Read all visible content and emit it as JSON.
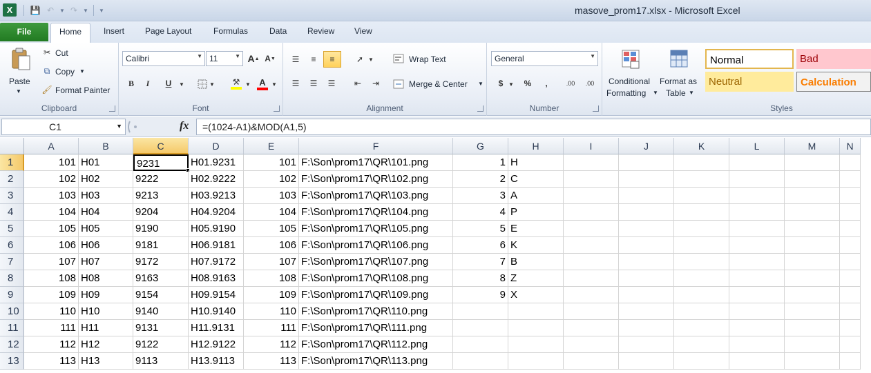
{
  "window": {
    "title": "masove_prom17.xlsx  -  Microsoft Excel"
  },
  "tabs": {
    "file": "File",
    "items": [
      "Home",
      "Insert",
      "Page Layout",
      "Formulas",
      "Data",
      "Review",
      "View"
    ]
  },
  "ribbon": {
    "clipboard": {
      "label": "Clipboard",
      "paste": "Paste",
      "cut": "Cut",
      "copy": "Copy",
      "format_painter": "Format Painter"
    },
    "font": {
      "label": "Font",
      "name": "Calibri",
      "size": "11"
    },
    "alignment": {
      "label": "Alignment",
      "wrap_text": "Wrap Text",
      "merge_center": "Merge & Center"
    },
    "number": {
      "label": "Number",
      "format": "General"
    },
    "styles": {
      "label": "Styles",
      "conditional": [
        "Conditional",
        "Formatting"
      ],
      "format_table": [
        "Format as",
        "Table"
      ],
      "normal": "Normal",
      "bad": "Bad",
      "neutral": "Neutral",
      "calculation": "Calculation"
    }
  },
  "formula_bar": {
    "name_box": "C1",
    "fx": "fx",
    "formula": "=(1024-A1)&MOD(A1,5)"
  },
  "sheet": {
    "columns": [
      "A",
      "B",
      "C",
      "D",
      "E",
      "F",
      "G",
      "H",
      "I",
      "J",
      "K",
      "L",
      "M",
      "N"
    ],
    "selected_col": "C",
    "selected_row": 1,
    "rows": [
      {
        "n": "1",
        "A": "101",
        "B": "H01",
        "C": "9231",
        "D": "H01.9231",
        "E": "101",
        "F": "F:\\Son\\prom17\\QR\\101.png",
        "G": "1",
        "H": "H"
      },
      {
        "n": "2",
        "A": "102",
        "B": "H02",
        "C": "9222",
        "D": "H02.9222",
        "E": "102",
        "F": "F:\\Son\\prom17\\QR\\102.png",
        "G": "2",
        "H": "C"
      },
      {
        "n": "3",
        "A": "103",
        "B": "H03",
        "C": "9213",
        "D": "H03.9213",
        "E": "103",
        "F": "F:\\Son\\prom17\\QR\\103.png",
        "G": "3",
        "H": "A"
      },
      {
        "n": "4",
        "A": "104",
        "B": "H04",
        "C": "9204",
        "D": "H04.9204",
        "E": "104",
        "F": "F:\\Son\\prom17\\QR\\104.png",
        "G": "4",
        "H": "P"
      },
      {
        "n": "5",
        "A": "105",
        "B": "H05",
        "C": "9190",
        "D": "H05.9190",
        "E": "105",
        "F": "F:\\Son\\prom17\\QR\\105.png",
        "G": "5",
        "H": "E"
      },
      {
        "n": "6",
        "A": "106",
        "B": "H06",
        "C": "9181",
        "D": "H06.9181",
        "E": "106",
        "F": "F:\\Son\\prom17\\QR\\106.png",
        "G": "6",
        "H": "K"
      },
      {
        "n": "7",
        "A": "107",
        "B": "H07",
        "C": "9172",
        "D": "H07.9172",
        "E": "107",
        "F": "F:\\Son\\prom17\\QR\\107.png",
        "G": "7",
        "H": "B"
      },
      {
        "n": "8",
        "A": "108",
        "B": "H08",
        "C": "9163",
        "D": "H08.9163",
        "E": "108",
        "F": "F:\\Son\\prom17\\QR\\108.png",
        "G": "8",
        "H": "Z"
      },
      {
        "n": "9",
        "A": "109",
        "B": "H09",
        "C": "9154",
        "D": "H09.9154",
        "E": "109",
        "F": "F:\\Son\\prom17\\QR\\109.png",
        "G": "9",
        "H": "X"
      },
      {
        "n": "10",
        "A": "110",
        "B": "H10",
        "C": "9140",
        "D": "H10.9140",
        "E": "110",
        "F": "F:\\Son\\prom17\\QR\\110.png",
        "G": "",
        "H": ""
      },
      {
        "n": "11",
        "A": "111",
        "B": "H11",
        "C": "9131",
        "D": "H11.9131",
        "E": "111",
        "F": "F:\\Son\\prom17\\QR\\111.png",
        "G": "",
        "H": ""
      },
      {
        "n": "12",
        "A": "112",
        "B": "H12",
        "C": "9122",
        "D": "H12.9122",
        "E": "112",
        "F": "F:\\Son\\prom17\\QR\\112.png",
        "G": "",
        "H": ""
      },
      {
        "n": "13",
        "A": "113",
        "B": "H13",
        "C": "9113",
        "D": "H13.9113",
        "E": "113",
        "F": "F:\\Son\\prom17\\QR\\113.png",
        "G": "",
        "H": ""
      }
    ]
  },
  "colors": {
    "file_tab": "#217a21",
    "selection": "#f5c96a",
    "bad_bg": "#ffc7ce",
    "neutral_bg": "#ffeb9c",
    "calculation_text": "#fa7d00"
  }
}
